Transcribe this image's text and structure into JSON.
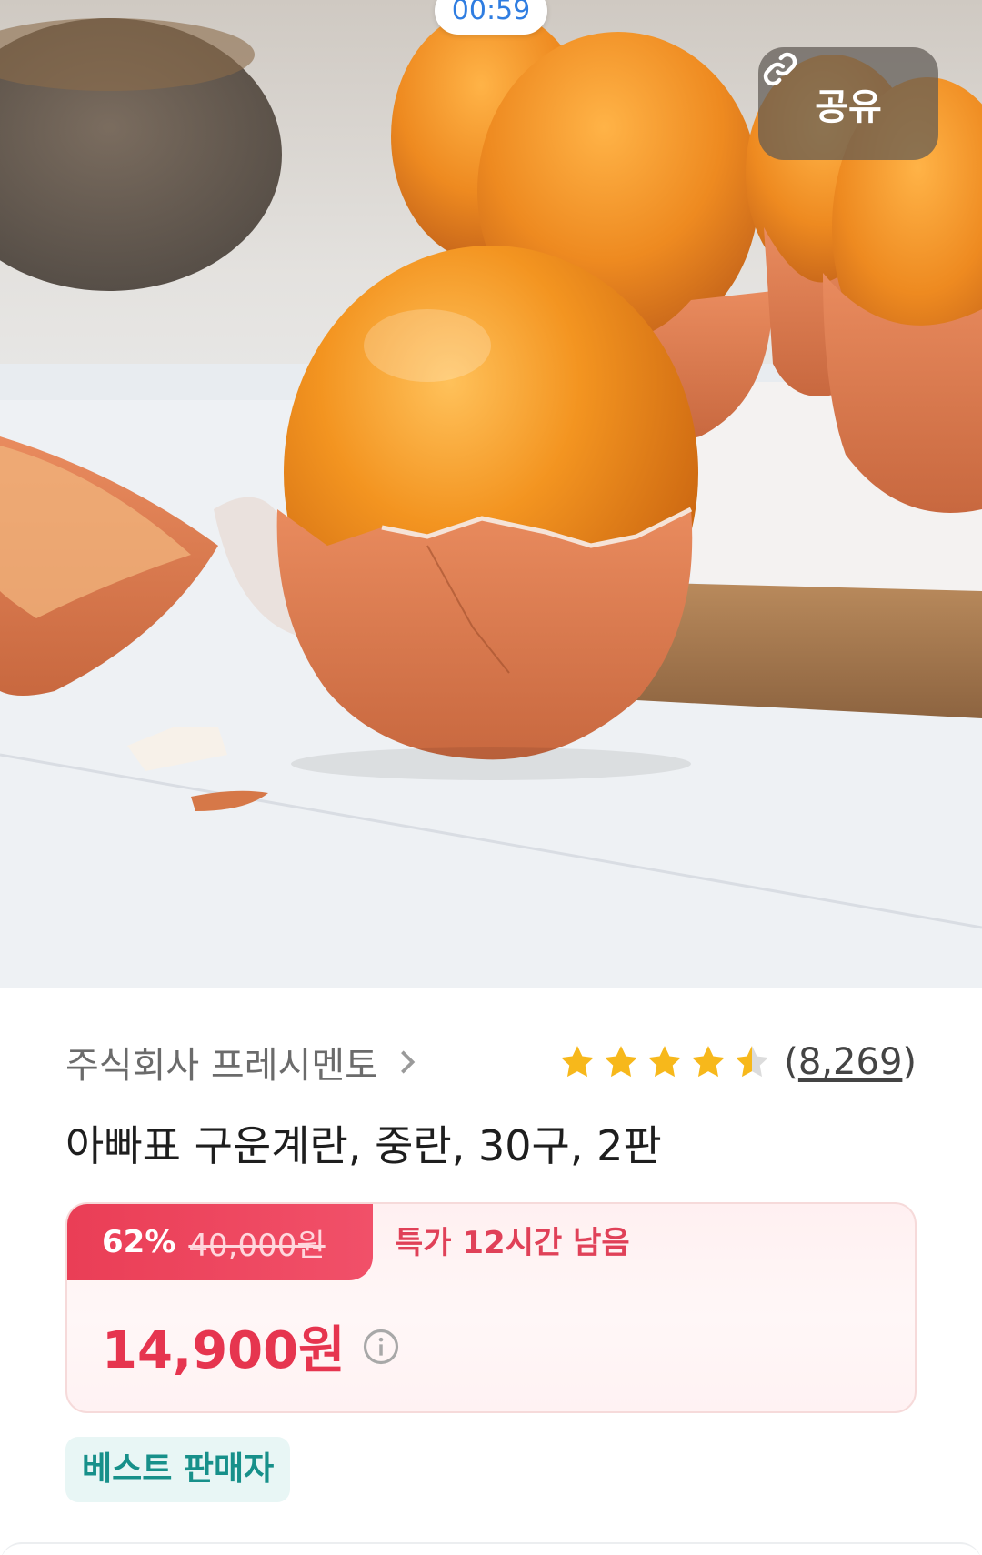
{
  "status": {
    "timer": "00:59"
  },
  "share": {
    "label": "공유",
    "icon": "link-icon"
  },
  "seller": {
    "name": "주식회사 프레시멘토",
    "icon": "chevron-right-icon"
  },
  "rating": {
    "stars": 4.5,
    "max_stars": 5,
    "review_count_open": "(",
    "review_count": "8,269",
    "review_count_close": ")",
    "star_color": "#f7b81b",
    "empty_star_color": "#dcdcdc"
  },
  "product": {
    "title": "아빠표 구운계란, 중란, 30구, 2판"
  },
  "price": {
    "discount_rate": "62%",
    "original_price": "40,000원",
    "deal_timer": "특가 12시간 남음",
    "sale_price": "14,900원",
    "accent_color": "#e6354f"
  },
  "badge": {
    "best_seller": "베스트 판매자"
  }
}
